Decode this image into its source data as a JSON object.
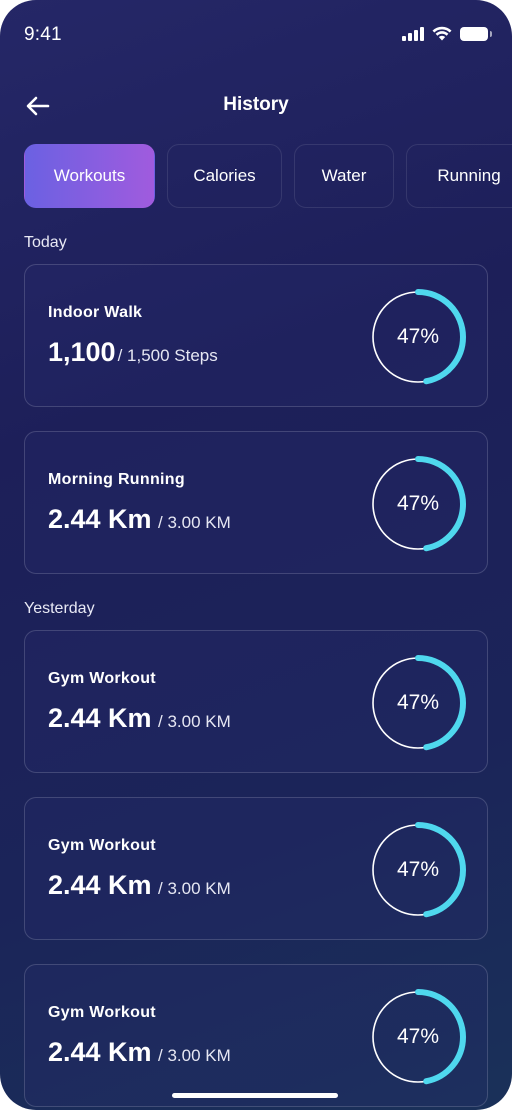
{
  "status_bar": {
    "time": "9:41"
  },
  "header": {
    "title": "History"
  },
  "tabs": [
    {
      "label": "Workouts",
      "active": true
    },
    {
      "label": "Calories",
      "active": false
    },
    {
      "label": "Water",
      "active": false
    },
    {
      "label": "Running",
      "active": false
    }
  ],
  "sections": [
    {
      "label": "Today",
      "cards": [
        {
          "title": "Indoor Walk",
          "value": "1,100",
          "goal": "/ 1,500 Steps",
          "percent_label": "47%",
          "progress": 0.47
        },
        {
          "title": "Morning Running",
          "value": "2.44 Km",
          "goal": "/ 3.00 KM",
          "percent_label": "47%",
          "progress": 0.47
        }
      ]
    },
    {
      "label": "Yesterday",
      "cards": [
        {
          "title": "Gym Workout",
          "value": "2.44 Km",
          "goal": "/ 3.00 KM",
          "percent_label": "47%",
          "progress": 0.47
        },
        {
          "title": "Gym Workout",
          "value": "2.44 Km",
          "goal": "/ 3.00 KM",
          "percent_label": "47%",
          "progress": 0.47
        },
        {
          "title": "Gym Workout",
          "value": "2.44 Km",
          "goal": "/ 3.00 KM",
          "percent_label": "47%",
          "progress": 0.47
        }
      ]
    }
  ],
  "colors": {
    "ring_progress": "#4fd8ee",
    "ring_track": "#ffffff",
    "tab_active_start": "#6b61e2",
    "tab_active_end": "#a05bde"
  },
  "icons": {
    "back": "arrow-left-icon",
    "signal": "cellular-signal-icon",
    "wifi": "wifi-icon",
    "battery": "battery-icon"
  }
}
